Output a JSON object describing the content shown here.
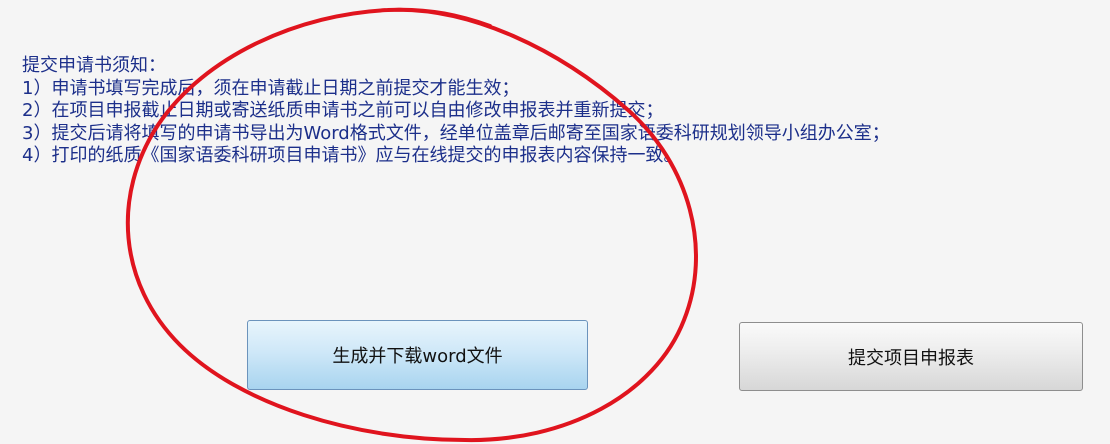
{
  "notice": {
    "title": "提交申请书须知：",
    "items": [
      "1）申请书填写完成后，须在申请截止日期之前提交才能生效；",
      "2）在项目申报截止日期或寄送纸质申请书之前可以自由修改申报表并重新提交；",
      "3）提交后请将填写的申请书导出为Word格式文件，经单位盖章后邮寄至国家语委科研规划领导小组办公室；",
      "4）打印的纸质《国家语委科研项目申请书》应与在线提交的申报表内容保持一致。"
    ]
  },
  "buttons": {
    "generate_label": "生成并下载word文件",
    "submit_label": "提交项目申报表"
  },
  "colors": {
    "notice_text": "#1c2f8a",
    "annotation_circle": "#e0141e",
    "generate_button": "#cfe8f8",
    "submit_button": "#ececec"
  }
}
